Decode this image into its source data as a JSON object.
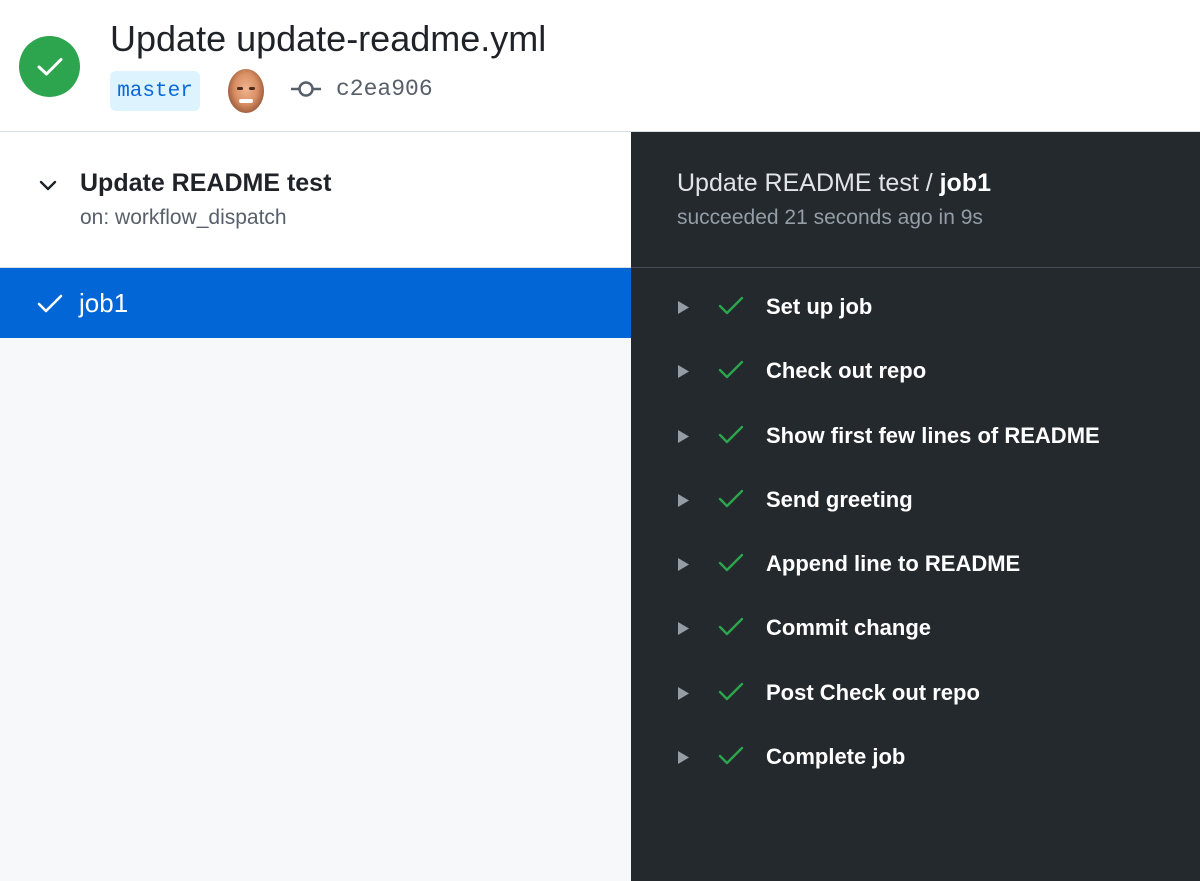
{
  "header": {
    "title": "Update update-readme.yml",
    "branch": "master",
    "commit_sha": "c2ea906",
    "status_color": "#2da44e"
  },
  "workflow": {
    "name": "Update README test",
    "trigger": "on: workflow_dispatch"
  },
  "jobs": [
    {
      "name": "job1",
      "status": "success",
      "selected": true
    }
  ],
  "job_detail": {
    "workflow_prefix": "Update README test / ",
    "job_name": "job1",
    "status_text": "succeeded 21 seconds ago in 9s",
    "steps": [
      {
        "label": "Set up job",
        "status": "success"
      },
      {
        "label": "Check out repo",
        "status": "success"
      },
      {
        "label": "Show first few lines of README",
        "status": "success"
      },
      {
        "label": "Send greeting",
        "status": "success"
      },
      {
        "label": "Append line to README",
        "status": "success"
      },
      {
        "label": "Commit change",
        "status": "success"
      },
      {
        "label": "Post Check out repo",
        "status": "success"
      },
      {
        "label": "Complete job",
        "status": "success"
      }
    ]
  },
  "colors": {
    "accent": "#0366d6",
    "success": "#2da44e",
    "dark_panel": "#24292e"
  }
}
